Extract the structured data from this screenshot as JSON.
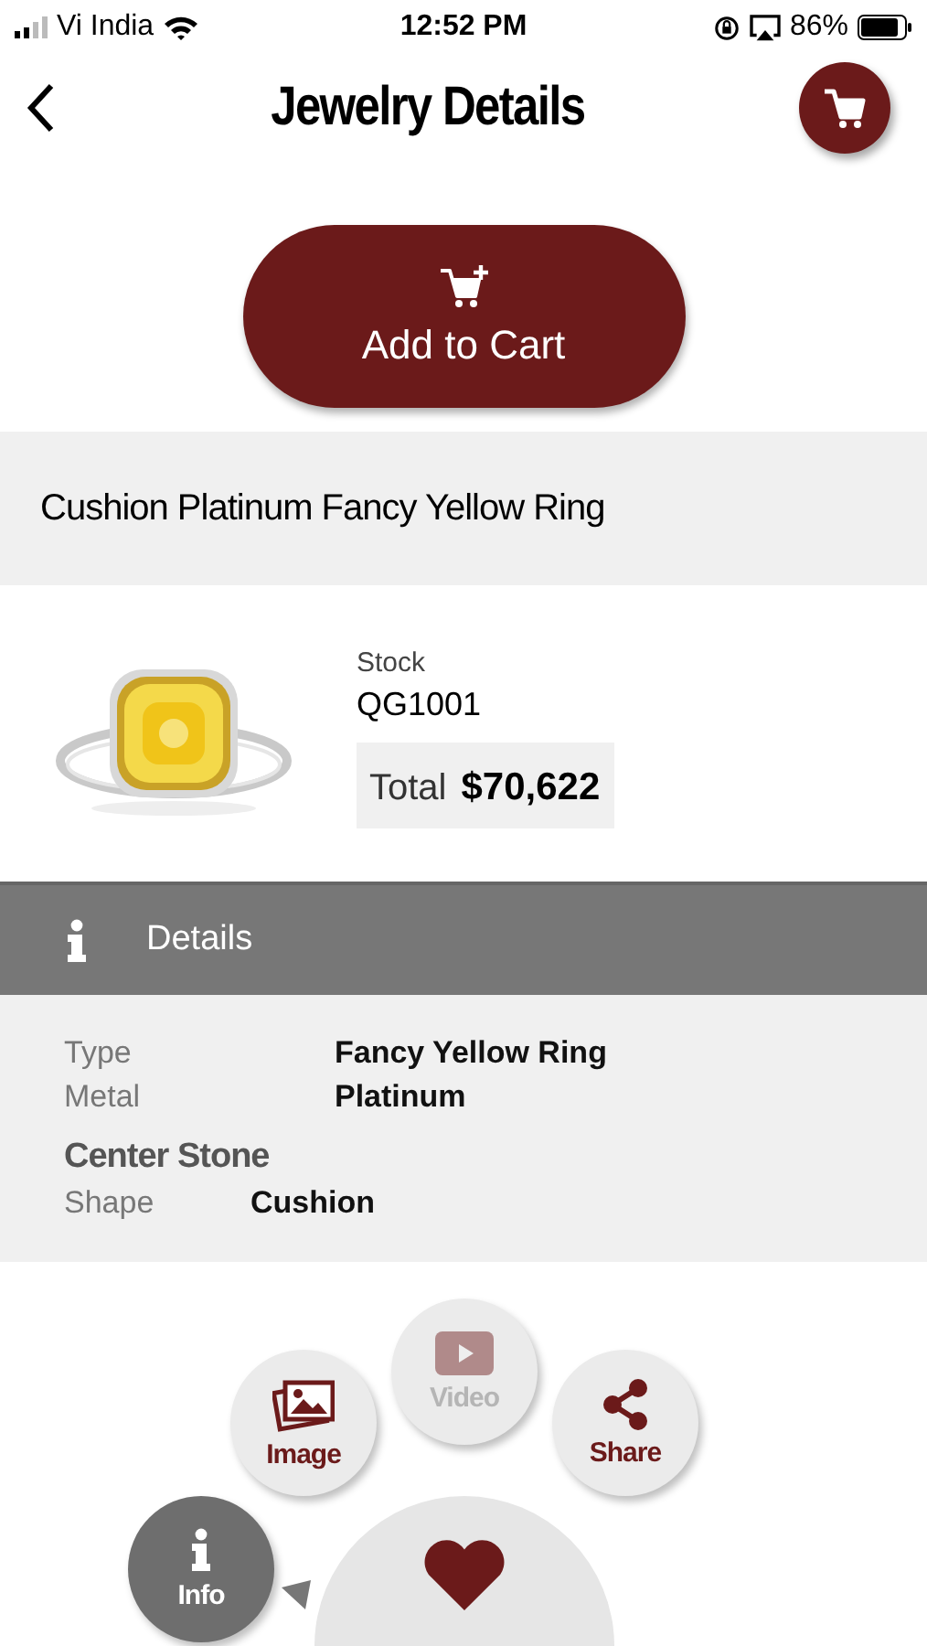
{
  "status_bar": {
    "carrier": "Vi India",
    "time": "12:52 PM",
    "battery": "86%"
  },
  "header": {
    "title": "Jewelry Details"
  },
  "add_to_cart": {
    "label": "Add to Cart"
  },
  "product": {
    "name": "Cushion Platinum Fancy Yellow Ring",
    "stock_label": "Stock",
    "stock": "QG1001",
    "total_label": "Total",
    "total": "$70,622"
  },
  "details": {
    "title": "Details",
    "rows": [
      {
        "label": "Type",
        "value": "Fancy Yellow Ring"
      },
      {
        "label": "Metal",
        "value": "Platinum"
      }
    ],
    "section": "Center Stone",
    "section_rows": [
      {
        "label": "Shape",
        "value": "Cushion"
      }
    ]
  },
  "menu": [
    {
      "label": "Image",
      "selected": false,
      "disabled": false
    },
    {
      "kind": "video",
      "label": "Video",
      "selected": false,
      "disabled": true
    },
    {
      "kind": "share",
      "label": "Share",
      "selected": false,
      "disabled": false
    },
    {
      "kind": "info",
      "label": "Info",
      "selected": true,
      "disabled": false
    }
  ]
}
